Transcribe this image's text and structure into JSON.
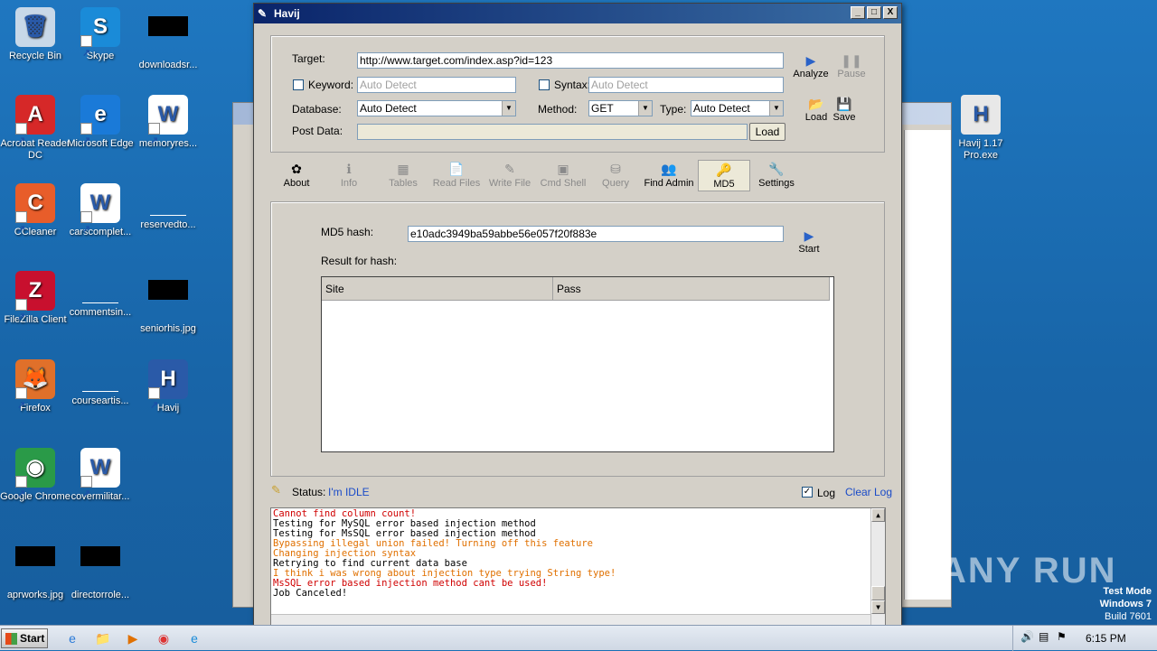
{
  "desktop_icons": [
    {
      "label": "Recycle Bin",
      "glyph": "🗑"
    },
    {
      "label": "Skype",
      "glyph": "S"
    },
    {
      "label": "downloadsr...",
      "glyph": ""
    },
    {
      "label": "Acrobat Reader DC",
      "glyph": "A"
    },
    {
      "label": "Microsoft Edge",
      "glyph": "e"
    },
    {
      "label": "memoryres...",
      "glyph": "W"
    },
    {
      "label": "CCleaner",
      "glyph": "C"
    },
    {
      "label": "carscomplet...",
      "glyph": "W"
    },
    {
      "label": "reservedto...",
      "glyph": ""
    },
    {
      "label": "FileZilla Client",
      "glyph": "Z"
    },
    {
      "label": "commentsin...",
      "glyph": ""
    },
    {
      "label": "seniorhis.jpg",
      "glyph": ""
    },
    {
      "label": "Firefox",
      "glyph": "🦊"
    },
    {
      "label": "courseartis...",
      "glyph": ""
    },
    {
      "label": "Havij",
      "glyph": "H"
    },
    {
      "label": "Google Chrome",
      "glyph": "◉"
    },
    {
      "label": "covermilitar...",
      "glyph": "W"
    },
    {
      "label": "aprworks.jpg",
      "glyph": ""
    },
    {
      "label": "directorrole...",
      "glyph": ""
    },
    {
      "label": "Havij 1.17 Pro.exe",
      "glyph": "H"
    }
  ],
  "window": {
    "title": "Havij",
    "min": "_",
    "max": "□",
    "close": "X"
  },
  "form": {
    "target_label": "Target:",
    "target_value": "http://www.target.com/index.asp?id=123",
    "keyword_label": "Keyword:",
    "keyword_value": "Auto Detect",
    "syntax_label": "Syntax:",
    "syntax_value": "Auto Detect",
    "database_label": "Database:",
    "database_value": "Auto Detect",
    "method_label": "Method:",
    "method_value": "GET",
    "type_label": "Type:",
    "type_value": "Auto Detect",
    "postdata_label": "Post Data:",
    "postdata_value": "",
    "load_button": "Load"
  },
  "actions": {
    "analyze": "Analyze",
    "pause": "Pause",
    "load": "Load",
    "save": "Save"
  },
  "tabs": [
    {
      "label": "About",
      "icon": "✿",
      "enabled": true
    },
    {
      "label": "Info",
      "icon": "ℹ",
      "enabled": false
    },
    {
      "label": "Tables",
      "icon": "▦",
      "enabled": false
    },
    {
      "label": "Read Files",
      "icon": "📄",
      "enabled": false
    },
    {
      "label": "Write File",
      "icon": "✎",
      "enabled": false
    },
    {
      "label": "Cmd Shell",
      "icon": "▣",
      "enabled": false
    },
    {
      "label": "Query",
      "icon": "⛁",
      "enabled": false
    },
    {
      "label": "Find Admin",
      "icon": "👥",
      "enabled": true
    },
    {
      "label": "MD5",
      "icon": "🔑",
      "enabled": true,
      "active": true
    },
    {
      "label": "Settings",
      "icon": "🔧",
      "enabled": true
    }
  ],
  "md5": {
    "hash_label": "MD5 hash:",
    "hash_value": "e10adc3949ba59abbe56e057f20f883e",
    "start_label": "Start",
    "result_label": "Result for hash:",
    "columns": [
      "Site",
      "Pass"
    ]
  },
  "status": {
    "label": "Status:",
    "value": "I'm IDLE",
    "log_label": "Log",
    "clear_log": "Clear Log"
  },
  "log_lines": [
    {
      "text": "Cannot find column count!",
      "color": "red"
    },
    {
      "text": "Testing for MySQL error based injection method",
      "color": "black"
    },
    {
      "text": "Testing for MsSQL error based injection method",
      "color": "black"
    },
    {
      "text": "Bypassing illegal union failed! Turning off this feature",
      "color": "orange"
    },
    {
      "text": "Changing injection syntax",
      "color": "orange"
    },
    {
      "text": "Retrying to find current data base",
      "color": "black"
    },
    {
      "text": "I think i was wrong about injection type trying String type!",
      "color": "orange"
    },
    {
      "text": "MsSQL error based injection method cant be used!",
      "color": "red"
    },
    {
      "text": "Job Canceled!",
      "color": "black"
    }
  ],
  "taskbar": {
    "start": "Start",
    "time": "6:15 PM"
  },
  "watermark": "ANY RUN",
  "test_mode": {
    "line1": "Test Mode",
    "line2": "Windows 7",
    "line3": "Build 7601"
  }
}
